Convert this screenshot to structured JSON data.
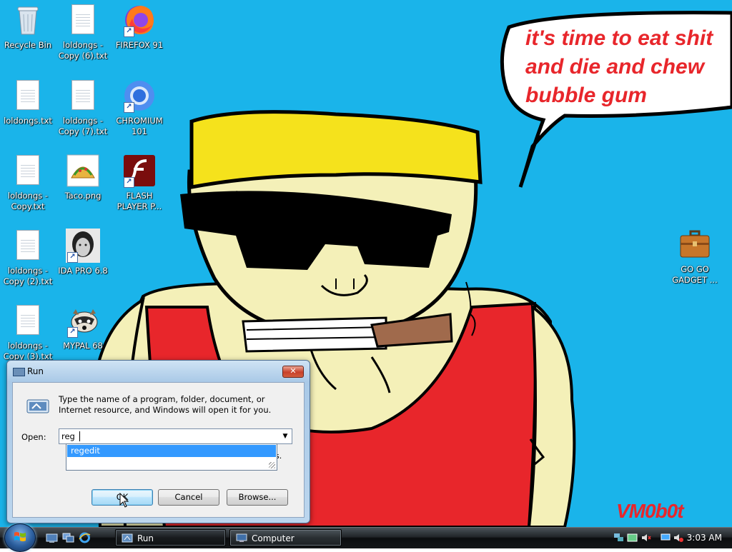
{
  "wallpaper": {
    "speech_text_lines": [
      "it's time to eat shit",
      "and die and chew",
      "bubble gum"
    ],
    "watermark": "VM0b0t"
  },
  "desktop_icons": [
    {
      "label": "Recycle Bin",
      "icon": "recycle-bin-icon"
    },
    {
      "label": "loldongs - Copy (6).txt",
      "icon": "text-file-icon"
    },
    {
      "label": "FIREFOX 91",
      "icon": "firefox-icon"
    },
    {
      "label": "loldongs.txt",
      "icon": "text-file-icon"
    },
    {
      "label": "loldongs - Copy (7).txt",
      "icon": "text-file-icon"
    },
    {
      "label": "CHROMIUM 101",
      "icon": "chromium-icon"
    },
    {
      "label": "loldongs - Copy.txt",
      "icon": "text-file-icon"
    },
    {
      "label": "Taco.png",
      "icon": "taco-image-icon"
    },
    {
      "label": "FLASH PLAYER P...",
      "icon": "flash-player-icon"
    },
    {
      "label": "loldongs - Copy (2).txt",
      "icon": "text-file-icon"
    },
    {
      "label": "IDA PRO 6.8",
      "icon": "ida-pro-icon"
    },
    {
      "label": "loldongs - Copy (3).txt",
      "icon": "text-file-icon"
    },
    {
      "label": "MYPAL 68",
      "icon": "mypal-raccoon-icon"
    },
    {
      "label": "GO GO GADGET ...",
      "icon": "briefcase-icon"
    }
  ],
  "run_dialog": {
    "title": "Run",
    "close_label": "✕",
    "description": "Type the name of a program, folder, document, or Internet resource, and Windows will open it for you.",
    "open_label": "Open:",
    "input_value": "reg",
    "autocomplete": [
      "regedit"
    ],
    "hint_tail": "s.",
    "ok_label": "OK",
    "cancel_label": "Cancel",
    "browse_label": "Browse..."
  },
  "taskbar": {
    "tasks": [
      {
        "label": "Run",
        "active": true
      },
      {
        "label": "Computer",
        "active": false
      }
    ],
    "clock": "3:03 AM"
  }
}
